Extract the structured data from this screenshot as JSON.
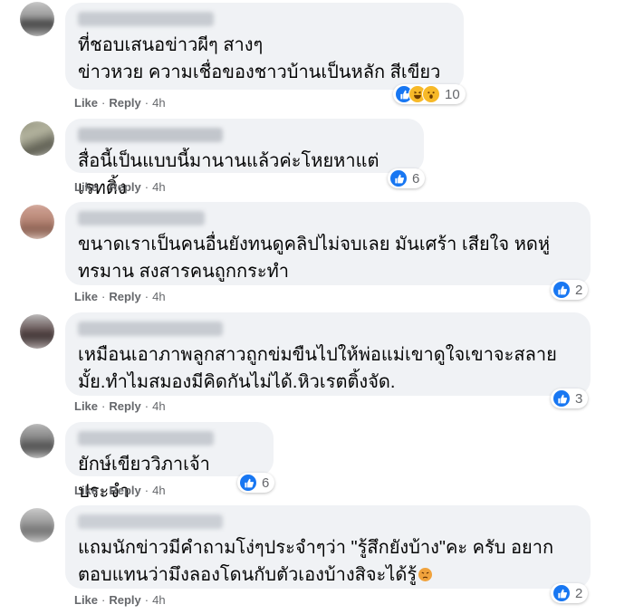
{
  "labels": {
    "like": "Like",
    "reply": "Reply",
    "sep": "·"
  },
  "comments": [
    {
      "text": "ที่ชอบเสนอข่าวผีๆ สางๆ\nข่าวหวย ความเชื่อของชาวบ้านเป็นหลัก สีเขียว",
      "time": "4h",
      "reactions": [
        "like-icon",
        "haha-icon",
        "wow-icon"
      ],
      "count": "10"
    },
    {
      "text": "สื่อนี้เป็นแบบนี้มานานแล้วค่ะโหยหาแต่เรทติ้ง",
      "time": "4h",
      "reactions": [
        "like-icon"
      ],
      "count": "6"
    },
    {
      "text": "ขนาดเราเป็นคนอื่นยังทนดูคลิปไม่จบเลย มันเศร้า เสียใจ หดหู่\nทรมาน สงสารคนถูกกระทำ",
      "time": "4h",
      "reactions": [
        "like-icon"
      ],
      "count": "2"
    },
    {
      "text": "เหมือนเอาภาพลูกสาวถูกข่มขืนไปให้พ่อแม่เขาดูใจเขาจะสลาย\nมั้ย.ทำไมสมองมีคิดกันไม่ได้.หิวเรตติ้งจัด.",
      "time": "4h",
      "reactions": [
        "like-icon"
      ],
      "count": "3"
    },
    {
      "text": "ยักษ์เขียววิภาเจ้าประจำ",
      "time": "4h",
      "reactions": [
        "like-icon"
      ],
      "count": "6"
    },
    {
      "text": "แถมนักข่าวมีคำถามโง่ๆประจำๆว่า \"รู้สึกยังบ้าง\"คะ ครับ อยาก\nตอบแทนว่ามึงลองโดนกับตัวเองบ้างสิจะได้รู้",
      "time": "4h",
      "reactions": [
        "like-icon"
      ],
      "count": "2",
      "inline_emoji": "angry-emoji-icon"
    }
  ],
  "colors": {
    "like": "#1877f2",
    "haha": "#f7b928",
    "bubble": "#f0f2f5",
    "meta": "#65676b"
  }
}
